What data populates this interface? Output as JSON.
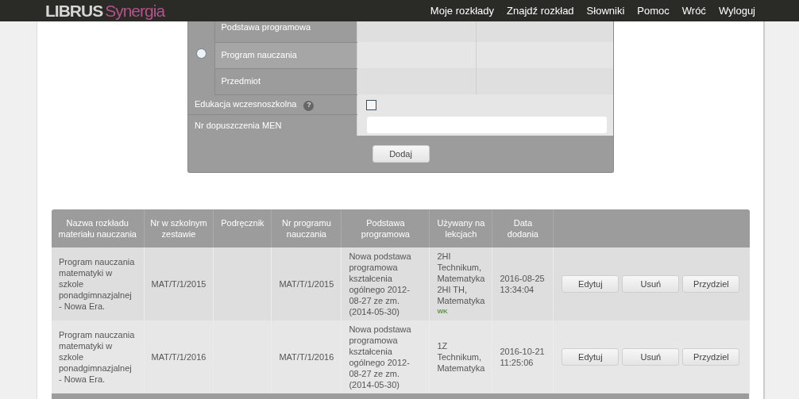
{
  "brand": {
    "name": "LIBRUS",
    "product": "Synergia"
  },
  "nav": [
    "Moje rozkłady",
    "Znajdź rozkład",
    "Słowniki",
    "Pomoc",
    "Wróć",
    "Wyloguj"
  ],
  "form": {
    "radio": {
      "selected": false
    },
    "choice_rows": [
      {
        "label": "Podstawa programowa"
      },
      {
        "label": "Program nauczania"
      },
      {
        "label": "Przedmiot"
      }
    ],
    "early_education": {
      "label": "Edukacja wczesnoszkolna",
      "help": "?",
      "checked": false
    },
    "approval_number": {
      "label": "Nr dopuszczenia MEN"
    },
    "submit": "Dodaj"
  },
  "table": {
    "columns": [
      "Nazwa rozkładu materiału nauczania",
      "Nr w szkolnym zestawie",
      "Podręcznik",
      "Nr programu nauczania",
      "Podstawa programowa",
      "Używany na lekcjach",
      "Data dodania"
    ],
    "rows": [
      {
        "name": "Program nauczania matematyki w szkole ponadgimnazjalnej - Nowa Era.",
        "school_number": "MAT/T/1/2015",
        "program_number": "MAT/T/1/2015",
        "curriculum": "Nowa podstawa programowa kształcenia ogólnego 2012-08-27 ze zm.(2014-05-30)",
        "lessons": "2HI Technikum, Matematyka 2HI TH, Matematyka",
        "tag": "WK",
        "date": "2016-08-25 13:34:04",
        "actions": [
          "Edytuj",
          "Usuń",
          "Przydziel"
        ]
      },
      {
        "name": "Program nauczania matematyki w szkole ponadgimnazjalnej - Nowa Era.",
        "school_number": "MAT/T/1/2016",
        "program_number": "MAT/T/1/2016",
        "curriculum": "Nowa podstawa programowa kształcenia ogólnego 2012-08-27 ze zm.(2014-05-30)",
        "lessons": "1Z Technikum, Matematyka",
        "date": "2016-10-21 11:25:06",
        "actions": [
          "Edytuj",
          "Usuń",
          "Przydziel"
        ]
      }
    ]
  }
}
